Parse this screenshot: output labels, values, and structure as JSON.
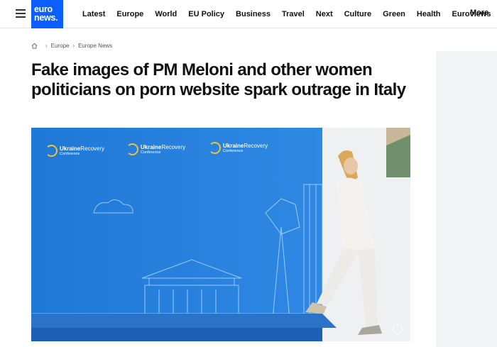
{
  "header": {
    "logo_line1": "euro",
    "logo_line2": "news.",
    "nav": [
      "Latest",
      "Europe",
      "World",
      "EU Policy",
      "Business",
      "Travel",
      "Next",
      "Culture",
      "Green",
      "Health",
      "Euroviews"
    ],
    "more_label": "More"
  },
  "breadcrumb": {
    "items": [
      "Europe",
      "Europe News"
    ]
  },
  "article": {
    "title": "Fake images of PM Meloni and other women politicians on porn website spark outrage in Italy"
  },
  "hero": {
    "conference_title_a": "Ukraine",
    "conference_title_b": "Recovery",
    "conference_sub": "Conference",
    "info_label": "i",
    "colors": {
      "backdrop": "#2a7fd8",
      "accent": "#f2c230",
      "floor": "#1d5fb4"
    }
  }
}
